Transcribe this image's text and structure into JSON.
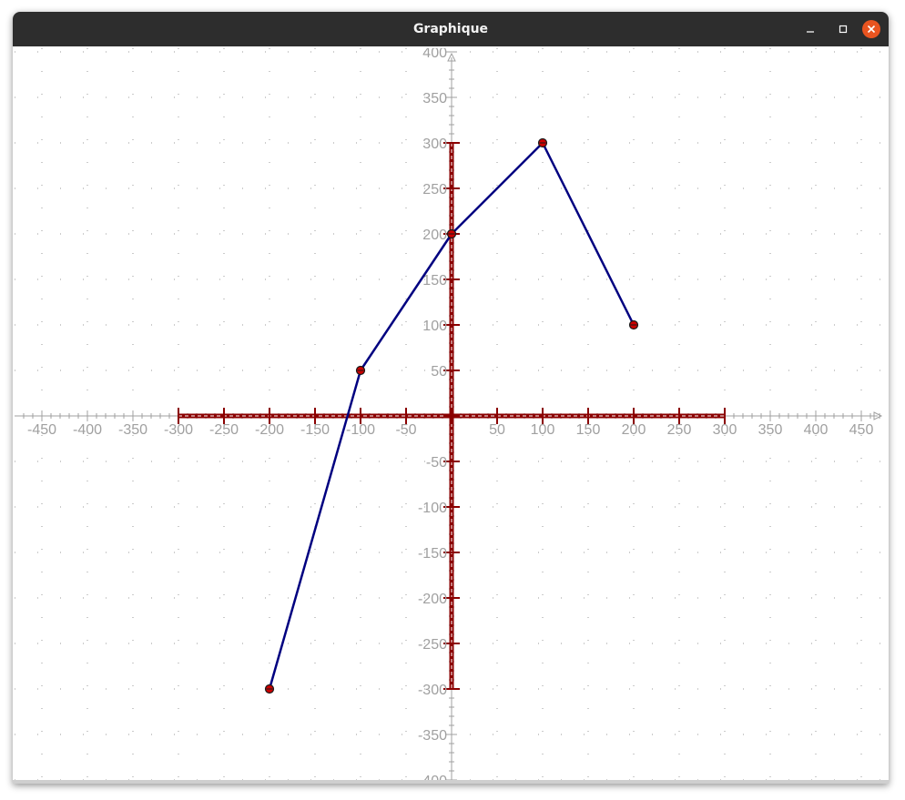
{
  "window": {
    "title": "Graphique"
  },
  "chart_data": {
    "type": "line",
    "xlim": [
      -475,
      475
    ],
    "ylim": [
      -400,
      400
    ],
    "grid": true,
    "x_ticks": [
      -450,
      -400,
      -350,
      -300,
      -250,
      -200,
      -150,
      -100,
      -50,
      50,
      100,
      150,
      200,
      250,
      300,
      350,
      400,
      450
    ],
    "y_ticks": [
      400,
      350,
      300,
      250,
      200,
      150,
      100,
      50,
      -50,
      -100,
      -150,
      -200,
      -250,
      -300,
      -350,
      -400
    ],
    "red_x_axis_range": [
      -300,
      300
    ],
    "red_y_axis_range": [
      -300,
      300
    ],
    "series": [
      {
        "x": [
          -200,
          -100,
          0,
          100,
          200
        ],
        "y": [
          -300,
          50,
          200,
          300,
          100
        ]
      }
    ]
  },
  "colors": {
    "title_bar": "#2d2d2d",
    "close_button": "#e95420",
    "line": "#000080",
    "highlight_axis": "#8b0000",
    "point_fill": "#cc0000",
    "axis_gray": "#a0a0a0"
  }
}
